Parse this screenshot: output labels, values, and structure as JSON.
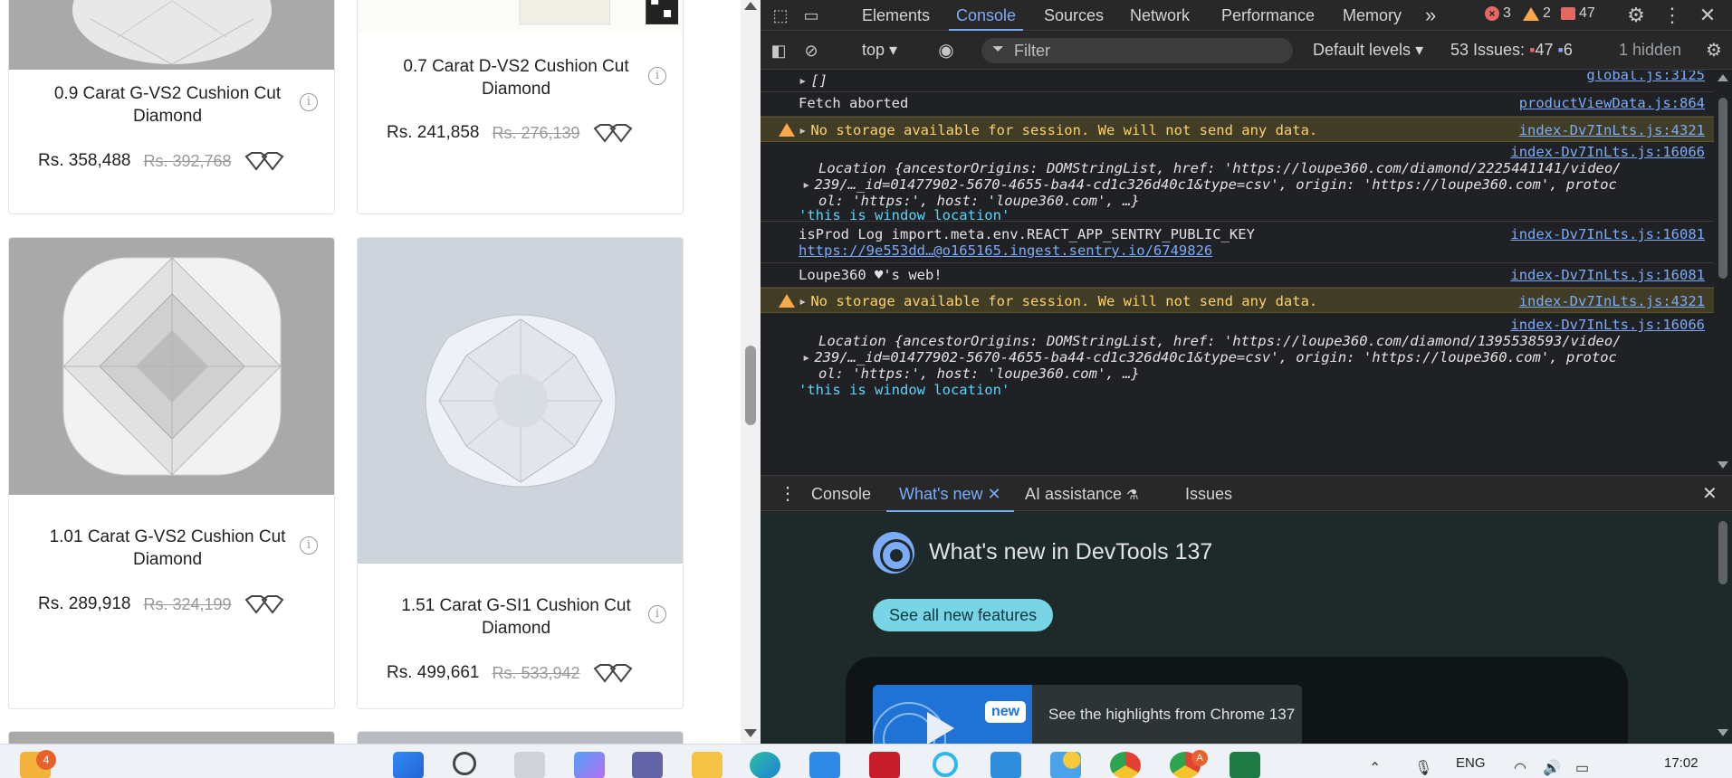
{
  "products": [
    {
      "title": "0.9 Carat G-VS2 Cushion Cut Diamond",
      "price": "Rs. 358,488",
      "old_price": "Rs. 392,768"
    },
    {
      "title": "0.7 Carat D-VS2 Cushion Cut Diamond",
      "price": "Rs. 241,858",
      "old_price": "Rs. 276,139"
    },
    {
      "title": "1.01 Carat G-VS2 Cushion Cut Diamond",
      "price": "Rs. 289,918",
      "old_price": "Rs. 324,199"
    },
    {
      "title": "1.51 Carat G-SI1 Cushion Cut Diamond",
      "price": "Rs. 499,661",
      "old_price": "Rs. 533,942"
    }
  ],
  "devtools": {
    "tabs": [
      "Elements",
      "Console",
      "Sources",
      "Network",
      "Performance",
      "Memory"
    ],
    "more_tabs": "»",
    "counts": {
      "errors": "3",
      "warnings": "2",
      "messages": "47"
    },
    "filterbar": {
      "context": "top",
      "filter_placeholder": "Filter",
      "levels": "Default levels",
      "issues_label": "53 Issues:",
      "issues_errors": "47",
      "issues_info": "6",
      "hidden": "1 hidden"
    },
    "console": [
      {
        "type": "log",
        "text": "[]",
        "source": "global.js:3125"
      },
      {
        "type": "log",
        "text": "Fetch aborted",
        "source": "productViewData.js:864"
      },
      {
        "type": "warn",
        "text": "No storage available for session. We will not send any data.",
        "source": "index-Dv7InLts.js:4321"
      },
      {
        "type": "location",
        "source": "index-Dv7InLts.js:16066",
        "line1": "Location {ancestorOrigins: DOMStringList, href: 'https://loupe360.com/diamond/2225441141/video/",
        "line2": "239/…_id=01477902-5670-4655-ba44-cd1c326d40c1&type=csv', origin: 'https://loupe360.com', protoc",
        "line3": "ol: 'https:', host: 'loupe360.com', …}",
        "line4": "'this is window location'"
      },
      {
        "type": "log",
        "text": "isProd Log import.meta.env.REACT_APP_SENTRY_PUBLIC_KEY",
        "link": "https://9e553dd…@o165165.ingest.sentry.io/6749826",
        "source": "index-Dv7InLts.js:16081"
      },
      {
        "type": "log",
        "text": "Loupe360 ♥'s web!",
        "source": "index-Dv7InLts.js:16081"
      },
      {
        "type": "warn",
        "text": "No storage available for session. We will not send any data.",
        "source": "index-Dv7InLts.js:4321"
      },
      {
        "type": "location",
        "source": "index-Dv7InLts.js:16066",
        "line1": "Location {ancestorOrigins: DOMStringList, href: 'https://loupe360.com/diamond/1395538593/video/",
        "line2": "239/…_id=01477902-5670-4655-ba44-cd1c326d40c1&type=csv', origin: 'https://loupe360.com', protoc",
        "line3": "ol: 'https:', host: 'loupe360.com', …}",
        "line4": "'this is window location'"
      }
    ],
    "drawer_tabs": [
      "Console",
      "What's new",
      "AI assistance",
      "Issues"
    ],
    "whats_new": {
      "title": "What's new in DevTools 137",
      "button": "See all new features",
      "badge": "new",
      "highlight": "See the highlights from Chrome 137"
    }
  },
  "taskbar": {
    "notification_count": "4",
    "language": "ENG",
    "time": "17:02",
    "chrome_badge": "A"
  },
  "colors": {
    "devtools_bg": "#202124",
    "accent_blue": "#7cacf8",
    "warn_bg": "#413c26",
    "teal_button": "#79d4e6"
  }
}
